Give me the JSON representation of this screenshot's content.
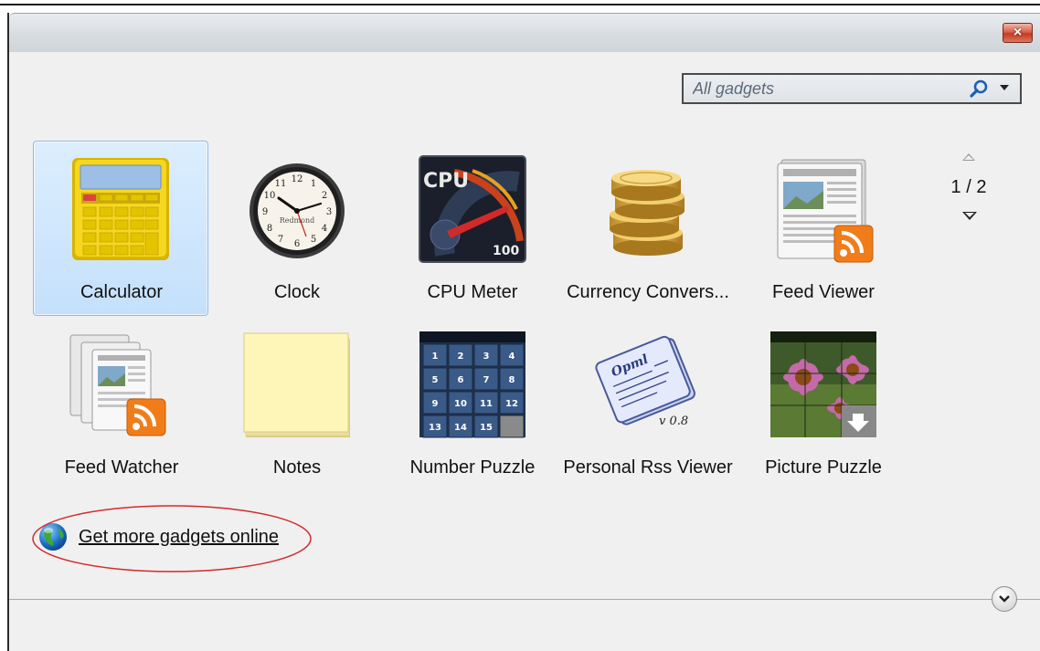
{
  "window": {
    "close_label": "×"
  },
  "search": {
    "placeholder": "All gadgets",
    "search_icon": "search-icon",
    "dropdown_icon": "chevron-down-icon"
  },
  "gadgets": [
    {
      "label": "Calculator",
      "icon": "calculator-icon",
      "selected": true
    },
    {
      "label": "Clock",
      "icon": "clock-icon",
      "selected": false
    },
    {
      "label": "CPU Meter",
      "icon": "cpu-meter-icon",
      "selected": false
    },
    {
      "label": "Currency Convers...",
      "icon": "currency-coins-icon",
      "selected": false
    },
    {
      "label": "Feed Viewer",
      "icon": "feed-viewer-icon",
      "selected": false
    },
    {
      "label": "Feed Watcher",
      "icon": "feed-watcher-icon",
      "selected": false
    },
    {
      "label": "Notes",
      "icon": "notes-icon",
      "selected": false
    },
    {
      "label": "Number Puzzle",
      "icon": "number-puzzle-icon",
      "selected": false
    },
    {
      "label": "Personal Rss Viewer",
      "icon": "personal-rss-viewer-icon",
      "selected": false
    },
    {
      "label": "Picture Puzzle",
      "icon": "picture-puzzle-icon",
      "selected": false
    }
  ],
  "icon_text": {
    "clock_brand": "Redmond",
    "cpu_title": "CPU",
    "cpu_value": "100",
    "rss_version": "v 0.8",
    "rss_paper_title": "Opml",
    "puzzle_numbers": [
      "1",
      "2",
      "3",
      "4",
      "5",
      "6",
      "7",
      "8",
      "9",
      "10",
      "11",
      "12",
      "13",
      "14",
      "15"
    ]
  },
  "pager": {
    "page_text": "1 / 2"
  },
  "get_more": {
    "label": "Get more gadgets online",
    "icon": "globe-icon"
  },
  "colors": {
    "selection_bg": "#c4e0fb",
    "selection_border": "#8fb8e8",
    "annotation": "#d42a2a",
    "rss_orange": "#f07d1a"
  }
}
